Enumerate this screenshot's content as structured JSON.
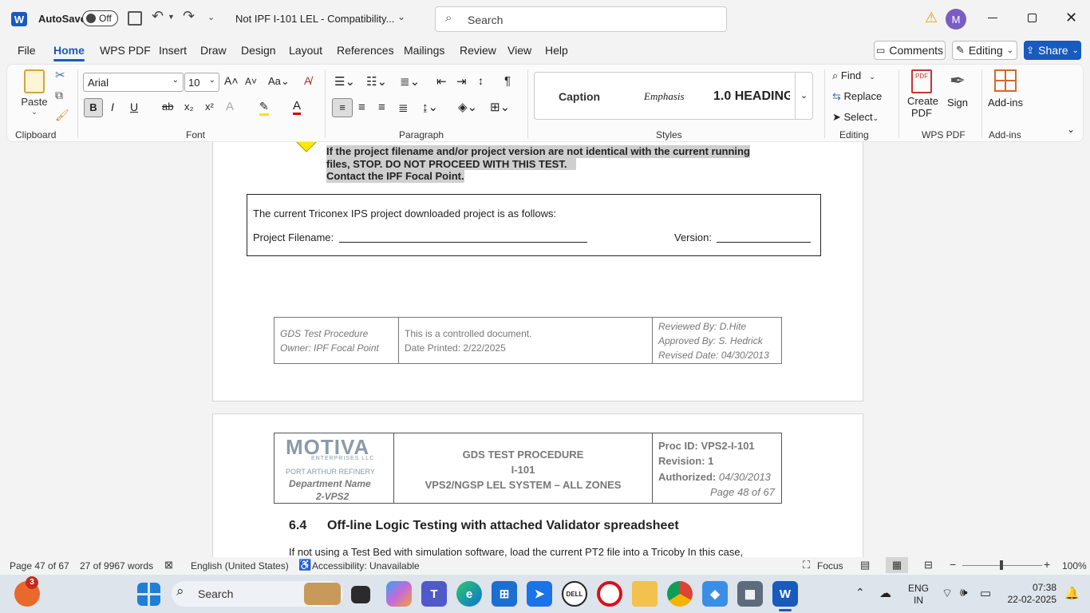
{
  "titlebar": {
    "app_initial": "W",
    "autosave_label": "AutoSave",
    "autosave_state": "Off",
    "doc_title": "Not IPF I-101 LEL  -  Compatibility...",
    "search_placeholder": "Search",
    "avatar_initial": "M"
  },
  "menu": {
    "tabs": [
      "File",
      "Home",
      "WPS PDF",
      "Insert",
      "Draw",
      "Design",
      "Layout",
      "References",
      "Mailings",
      "Review",
      "View",
      "Help"
    ],
    "comments": "Comments",
    "editing": "Editing",
    "share": "Share"
  },
  "ribbon": {
    "paste": "Paste",
    "font_name": "Arial",
    "font_size": "10",
    "styles": [
      "Caption",
      "Emphasis",
      "1.0  HEADING"
    ],
    "find": "Find",
    "replace": "Replace",
    "select": "Select",
    "create_pdf_1": "Create",
    "create_pdf_2": "PDF",
    "sign": "Sign",
    "addins": "Add-ins",
    "groups": [
      "Clipboard",
      "Font",
      "Paragraph",
      "Styles",
      "Editing",
      "WPS PDF",
      "Add-ins"
    ]
  },
  "page1": {
    "warning_1": "If the project filename and/or project version are not identical with the current running",
    "warning_2": "files, STOP. DO NOT PROCEED WITH THIS TEST.",
    "warning_3": "Contact the IPF Focal Point.",
    "box_line": "The current Triconex IPS project downloaded project is as follows:",
    "filename_label": "Project Filename:",
    "version_label": "Version:",
    "footer_left_1": "GDS Test Procedure",
    "footer_left_2": "Owner: IPF Focal Point",
    "footer_mid_1": "This is a controlled document.",
    "footer_mid_2": "Date Printed: 2/22/2025",
    "footer_right_1": "Reviewed By: D.Hite",
    "footer_right_2": "Approved By: S. Hedrick",
    "footer_right_3": "Revised Date: 04/30/2013"
  },
  "page2": {
    "logo": "MOTIVA",
    "logo_sub": "ENTERPRISES LLC",
    "refinery": "PORT ARTHUR REFINERY",
    "dept_1": "Department Name",
    "dept_2": "2-VPS2",
    "hdr_1": "GDS TEST PROCEDURE",
    "hdr_2": "I-101",
    "hdr_3": "VPS2/NGSP LEL SYSTEM – ALL ZONES",
    "proc_id": "Proc ID: VPS2-I-101",
    "revision": "Revision: 1",
    "authorized_label": "Authorized:",
    "authorized_date": "04/30/2013",
    "page_of": "Page 48 of 67",
    "heading_num": "6.4",
    "heading": "Off-line Logic Testing with attached Validator spreadsheet",
    "body": "If not using a Test Bed with simulation software, load the current PT2 file into a Tricoby In this case,"
  },
  "status": {
    "page": "Page 47 of 67",
    "words": "27 of 9967 words",
    "language": "English (United States)",
    "accessibility": "Accessibility: Unavailable",
    "focus": "Focus",
    "zoom": "100%"
  },
  "taskbar": {
    "badge": "3",
    "search": "Search",
    "lang_1": "ENG",
    "lang_2": "IN",
    "time": "07:38",
    "date": "22-02-2025"
  },
  "colors": {
    "accent": "#185abd",
    "highlight": "#c8c8c8",
    "taskbar": "#dde4ec"
  }
}
